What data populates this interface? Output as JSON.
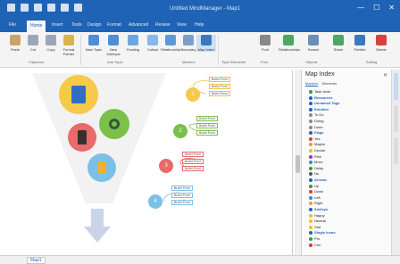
{
  "window": {
    "title": "Untitled MindManager - Map1",
    "controls": [
      "—",
      "☐",
      "✕"
    ]
  },
  "tabs": [
    "File",
    "Home",
    "Insert",
    "Tools",
    "Design",
    "Format",
    "Advanced",
    "Review",
    "View",
    "Help"
  ],
  "ribbon": {
    "buttons": [
      "Paste",
      "Cut",
      "Copy",
      "Format Painter",
      "New Topic",
      "New Subtopic",
      "Floating",
      "Callout",
      "Relationship",
      "Boundary",
      "Map Index",
      "Font",
      "Relationships",
      "Search",
      "Share",
      "Publish",
      "Delete"
    ],
    "groups": [
      "Clipboard",
      "Add Topic",
      "Markers",
      "Topic Elements",
      "Font",
      "Objects",
      "Editing"
    ]
  },
  "map": {
    "topics": [
      "1",
      "2",
      "3",
      "4"
    ],
    "subtopics": [
      "Bullet Point",
      "Bullet Point",
      "Bullet Point"
    ]
  },
  "panel": {
    "title": "Map Index",
    "tabs": [
      "Markers",
      "Elements"
    ],
    "items": [
      {
        "label": "Task done",
        "color": "#2e9e3e",
        "head": false
      },
      {
        "label": "Resources",
        "color": "#1e63b5",
        "head": true
      },
      {
        "label": "Unnamed Tags",
        "color": "#1e63b5",
        "head": true
      },
      {
        "label": "Emotion",
        "color": "#1e63b5",
        "head": true
      },
      {
        "label": "To Do",
        "color": "#888888",
        "head": false
      },
      {
        "label": "Doing",
        "color": "#888888",
        "head": false
      },
      {
        "label": "Done",
        "color": "#888888",
        "head": false
      },
      {
        "label": "Flags",
        "color": "#1e63b5",
        "head": true
      },
      {
        "label": "Yes",
        "color": "#d83b3b",
        "head": false
      },
      {
        "label": "Maybe",
        "color": "#f0a020",
        "head": false
      },
      {
        "label": "Decide",
        "color": "#e6c820",
        "head": false
      },
      {
        "label": "Risk",
        "color": "#8a3ab9",
        "head": false
      },
      {
        "label": "Move",
        "color": "#2e8bd6",
        "head": false
      },
      {
        "label": "Delay",
        "color": "#2e9e3e",
        "head": false
      },
      {
        "label": "No",
        "color": "#555555",
        "head": false
      },
      {
        "label": "Arrows",
        "color": "#1e63b5",
        "head": true
      },
      {
        "label": "Up",
        "color": "#2e9e3e",
        "head": false
      },
      {
        "label": "Down",
        "color": "#d83b3b",
        "head": false
      },
      {
        "label": "Left",
        "color": "#2e8bd6",
        "head": false
      },
      {
        "label": "Right",
        "color": "#f0a020",
        "head": false
      },
      {
        "label": "Smileys",
        "color": "#1e63b5",
        "head": true
      },
      {
        "label": "Happy",
        "color": "#f0c020",
        "head": false
      },
      {
        "label": "Neutral",
        "color": "#f0c020",
        "head": false
      },
      {
        "label": "Sad",
        "color": "#f0c020",
        "head": false
      },
      {
        "label": "Single Icons",
        "color": "#1e63b5",
        "head": true
      },
      {
        "label": "Pro",
        "color": "#2e9e3e",
        "head": false
      },
      {
        "label": "Con",
        "color": "#d83b3b",
        "head": false
      }
    ]
  },
  "statusbar": {
    "sheet": "Map1"
  }
}
